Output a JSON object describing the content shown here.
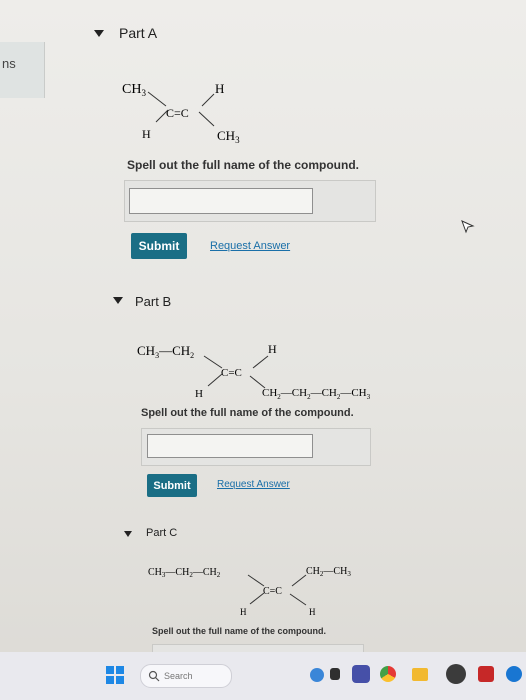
{
  "left_strip": {
    "text": "ns"
  },
  "parts": [
    {
      "title": "Part A",
      "prompt": "Spell out the full name of the compound.",
      "submit_label": "Submit",
      "request_label": "Request Answer",
      "molecule": {
        "top_left": "CH3",
        "top_right": "H",
        "bond": "C=C",
        "bottom_left": "H",
        "bottom_right": "CH3"
      }
    },
    {
      "title": "Part B",
      "prompt": "Spell out the full name of the compound.",
      "submit_label": "Submit",
      "request_label": "Request Answer",
      "molecule": {
        "top_left": "CH3—CH2",
        "top_right": "H",
        "bond": "C=C",
        "bottom_left": "H",
        "bottom_right": "CH2—CH2—CH2—CH3"
      }
    },
    {
      "title": "Part C",
      "prompt": "Spell out the full name of the compound.",
      "molecule": {
        "top_left": "CH3—CH2—CH2",
        "top_right": "CH2—CH3",
        "bond": "C=C",
        "bottom_left": "H",
        "bottom_right": "H"
      }
    }
  ],
  "taskbar": {
    "search_placeholder": "Search",
    "icons": [
      "windows-start-icon",
      "search-icon",
      "edge-browser-icon",
      "widget-icon",
      "teams-icon",
      "chrome-icon",
      "file-explorer-icon",
      "dell-icon",
      "mcafee-icon",
      "app-icon"
    ]
  }
}
